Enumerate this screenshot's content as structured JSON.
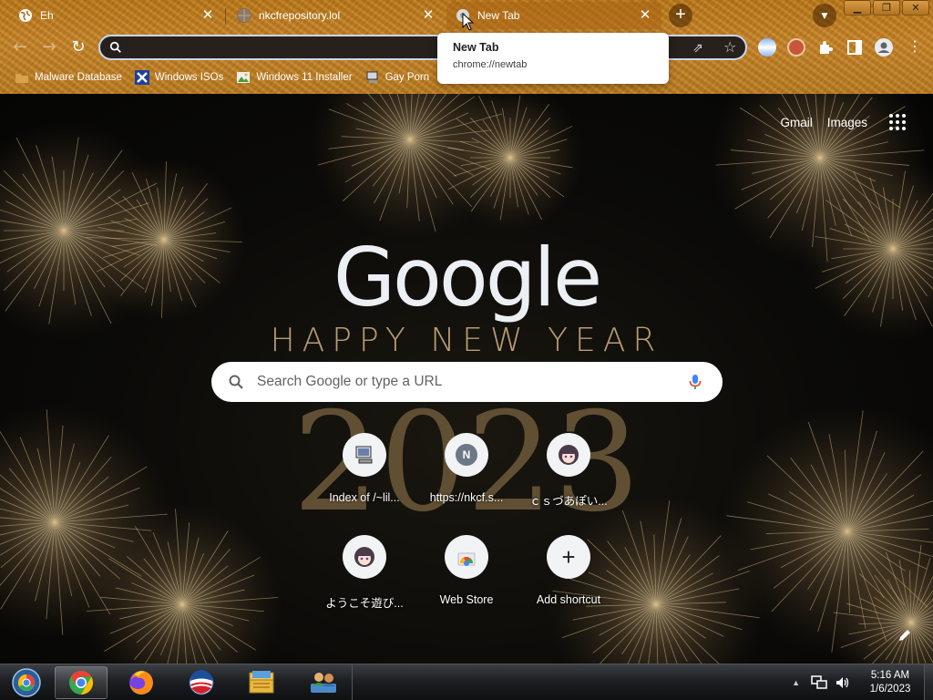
{
  "tabs": [
    {
      "title": "Eh",
      "icon": "globe-icon"
    },
    {
      "title": "nkcfrepository.lol",
      "icon": "globe-icon"
    },
    {
      "title": "New Tab",
      "icon": "chrome-icon",
      "active": true
    }
  ],
  "tooltip": {
    "title": "New Tab",
    "url": "chrome://newtab"
  },
  "omnibox": {
    "value": "",
    "placeholder": ""
  },
  "bookmarks": [
    {
      "label": "Malware Database",
      "icon": "folder-icon"
    },
    {
      "label": "Windows ISOs",
      "icon": "x-logo-icon"
    },
    {
      "label": "Windows 11 Installer",
      "icon": "image-icon"
    },
    {
      "label": "Gay Porn",
      "icon": "computer-icon"
    }
  ],
  "top_links": {
    "gmail": "Gmail",
    "images": "Images"
  },
  "doodle": {
    "logo": "Google",
    "line1": "HAPPY NEW YEAR",
    "line2": "2023"
  },
  "search": {
    "placeholder": "Search Google or type a URL"
  },
  "shortcuts": [
    {
      "label": "Index of /~lil...",
      "icon": "computer-icon"
    },
    {
      "label": "https://nkcf.s...",
      "icon": "letter-n-icon",
      "letter": "N"
    },
    {
      "label": "ｃｓづあぽい...",
      "icon": "anime-avatar-icon"
    },
    {
      "label": "ようこそ遊び...",
      "icon": "anime-avatar-icon"
    },
    {
      "label": "Web Store",
      "icon": "web-store-icon"
    },
    {
      "label": "Add shortcut",
      "icon": "plus-icon",
      "glyph": "+"
    }
  ],
  "taskbar": {
    "items": [
      "windows-start-icon",
      "chrome-icon",
      "firefox-icon",
      "obama-logo-icon",
      "file-explorer-icon",
      "network-people-icon"
    ],
    "clock_time": "5:16 AM",
    "clock_date": "1/6/2023"
  },
  "colors": {
    "chrome_frame": "#b8761a",
    "omnibox_bg": "#26211c",
    "omnibox_border": "#c9d7f2",
    "mic_blue": "#4285f4",
    "taskbar": "#1d1f22"
  }
}
